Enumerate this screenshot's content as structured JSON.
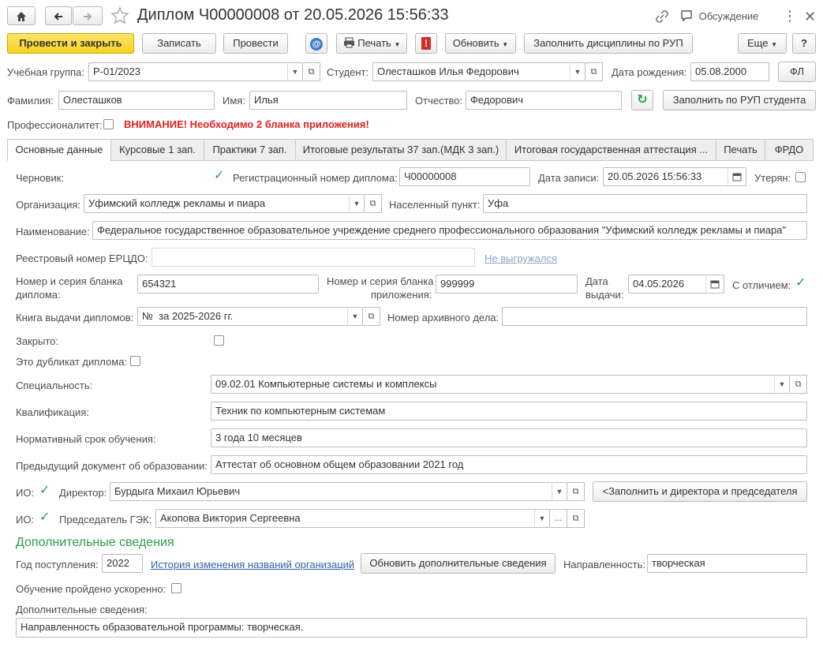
{
  "window": {
    "title": "Диплом Ч00000008 от 20.05.2026 15:56:33",
    "discussion_label": "Обсуждение"
  },
  "toolbar": {
    "post_close": "Провести и закрыть",
    "write": "Записать",
    "post": "Провести",
    "print": "Печать",
    "refresh": "Обновить",
    "fill_disc": "Заполнить дисциплины по РУП",
    "more": "Еще",
    "help": "?"
  },
  "header": {
    "group_label": "Учебная группа:",
    "group_value": "Р-01/2023",
    "student_label": "Студент:",
    "student_value": "Олесташков Илья Федорович",
    "birth_label": "Дата рождения:",
    "birth_value": "05.08.2000",
    "fl_button": "ФЛ",
    "surname_label": "Фамилия:",
    "surname_value": "Олесташков",
    "name_label": "Имя:",
    "name_value": "Илья",
    "patronymic_label": "Отчество:",
    "patronymic_value": "Федорович",
    "fill_rup_button": "Заполнить по РУП студента",
    "prof_label": "Профессионалитет:",
    "warning": "ВНИМАНИЕ! Необходимо 2 бланка приложения!"
  },
  "tabs": [
    "Основные данные",
    "Курсовые 1 зап.",
    "Практики 7 зап.",
    "Итоговые результаты 37 зап.(МДК 3 зап.)",
    "Итоговая государственная аттестация ...",
    "Печать",
    "ФРДО"
  ],
  "main": {
    "draft_label": "Черновик:",
    "reg_label": "Регистрационный номер диплома:",
    "reg_value": "Ч00000008",
    "record_date_label": "Дата записи:",
    "record_date_value": "20.05.2026 15:56:33",
    "lost_label": "Утерян:",
    "org_label": "Организация:",
    "org_value": "Уфимский колледж рекламы и пиара",
    "city_label": "Населенный пункт:",
    "city_value": "Уфа",
    "fullname_label": "Наименование:",
    "fullname_value": "Федеральное государственное образовательное учреждение среднего профессионального образования \"Уфимский колледж рекламы и пиара\"",
    "ercdo_label": "Реестровый номер ЕРЦДО:",
    "ercdo_value": "",
    "not_uploaded": "Не выгружался",
    "blank_label_1": "Номер и серия бланка",
    "blank_label_2": "диплома:",
    "blank_value": "654321",
    "app_label_1": "Номер и серия бланка",
    "app_label_2": "приложения:",
    "app_value": "999999",
    "issue_label_1": "Дата",
    "issue_label_2": "выдачи:",
    "issue_value": "04.05.2026",
    "honors_label": "С отличием:",
    "book_label": "Книга выдачи дипломов:",
    "book_value": "№  за 2025-2026 гг.",
    "archive_label": "Номер архивного дела:",
    "archive_value": "",
    "closed_label": "Закрыто:",
    "duplicate_label": "Это дубликат диплома:",
    "specialty_label": "Специальность:",
    "specialty_value": "09.02.01 Компьютерные системы и комплексы",
    "qualification_label": "Квалификация:",
    "qualification_value": "Техник по компьютерным системам",
    "term_label": "Нормативный срок обучения:",
    "term_value": "3 года 10 месяцев",
    "prev_doc_label": "Предыдущий документ об образовании:",
    "prev_doc_value": "Аттестат об основном общем образовании 2021 год",
    "io_label": "ИО:",
    "director_label": "Директор:",
    "director_value": "Бурдыга Михаил Юрьевич",
    "fill_both_button": "<Заполнить и директора и председателя",
    "chair_label": "Председатель ГЭК:",
    "chair_value": "Акопова Виктория Сергеевна",
    "more_dots": "..."
  },
  "extra": {
    "section_title": "Дополнительные сведения",
    "year_label": "Год поступления:",
    "year_value": "2022",
    "history_link": "История изменения названий организаций",
    "update_button": "Обновить дополнительные сведения",
    "direction_label": "Направленность:",
    "direction_value": "творческая",
    "accelerated_label": "Обучение пройдено ускоренно:",
    "info_label": "Дополнительные сведения:",
    "info_value": "Направленность образовательной программы: творческая."
  },
  "colors": {
    "accent_yellow": "#f5d31e",
    "warning_red": "#e02020",
    "check_green": "#2a9d3a",
    "section_green": "#2a9d4a",
    "link_blue": "#2f5fa8"
  },
  "icons": {
    "home": "home-icon",
    "back": "arrow-left-icon",
    "forward": "arrow-right-icon",
    "star": "star-icon",
    "link": "link-icon",
    "chat": "chat-icon",
    "menu": "kebab-menu-icon",
    "close": "close-icon",
    "at": "email-at-icon",
    "printer": "printer-icon",
    "alert": "exclamation-icon",
    "refresh": "refresh-icon",
    "calendar": "calendar-icon"
  }
}
